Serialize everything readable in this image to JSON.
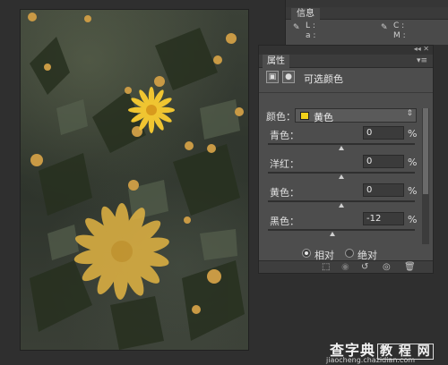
{
  "info_panel": {
    "tab": "信息",
    "lab_l": "L :",
    "lab_a": "a :",
    "cmyk_c": "C :",
    "cmyk_m": "M :"
  },
  "properties": {
    "tab": "属性",
    "menu": "▾≡",
    "collapse": "◂◂ ✕",
    "title": "可选颜色",
    "colors_label": "颜色：",
    "colors_value": "黄色",
    "swatch_color": "#f2d21a",
    "sliders": [
      {
        "label": "青色：",
        "value": "0",
        "unit": "%",
        "position_pct": 50
      },
      {
        "label": "洋红：",
        "value": "0",
        "unit": "%",
        "position_pct": 50
      },
      {
        "label": "黄色：",
        "value": "0",
        "unit": "%",
        "position_pct": 50
      },
      {
        "label": "黑色：",
        "value": "-12",
        "unit": "%",
        "position_pct": 44
      }
    ],
    "method_relative": "相对",
    "method_absolute": "绝对",
    "method_selected": "relative"
  },
  "watermark": {
    "brand": "查字典",
    "box_text": "教 程 网",
    "url": "jiaocheng.chazidian.com"
  }
}
